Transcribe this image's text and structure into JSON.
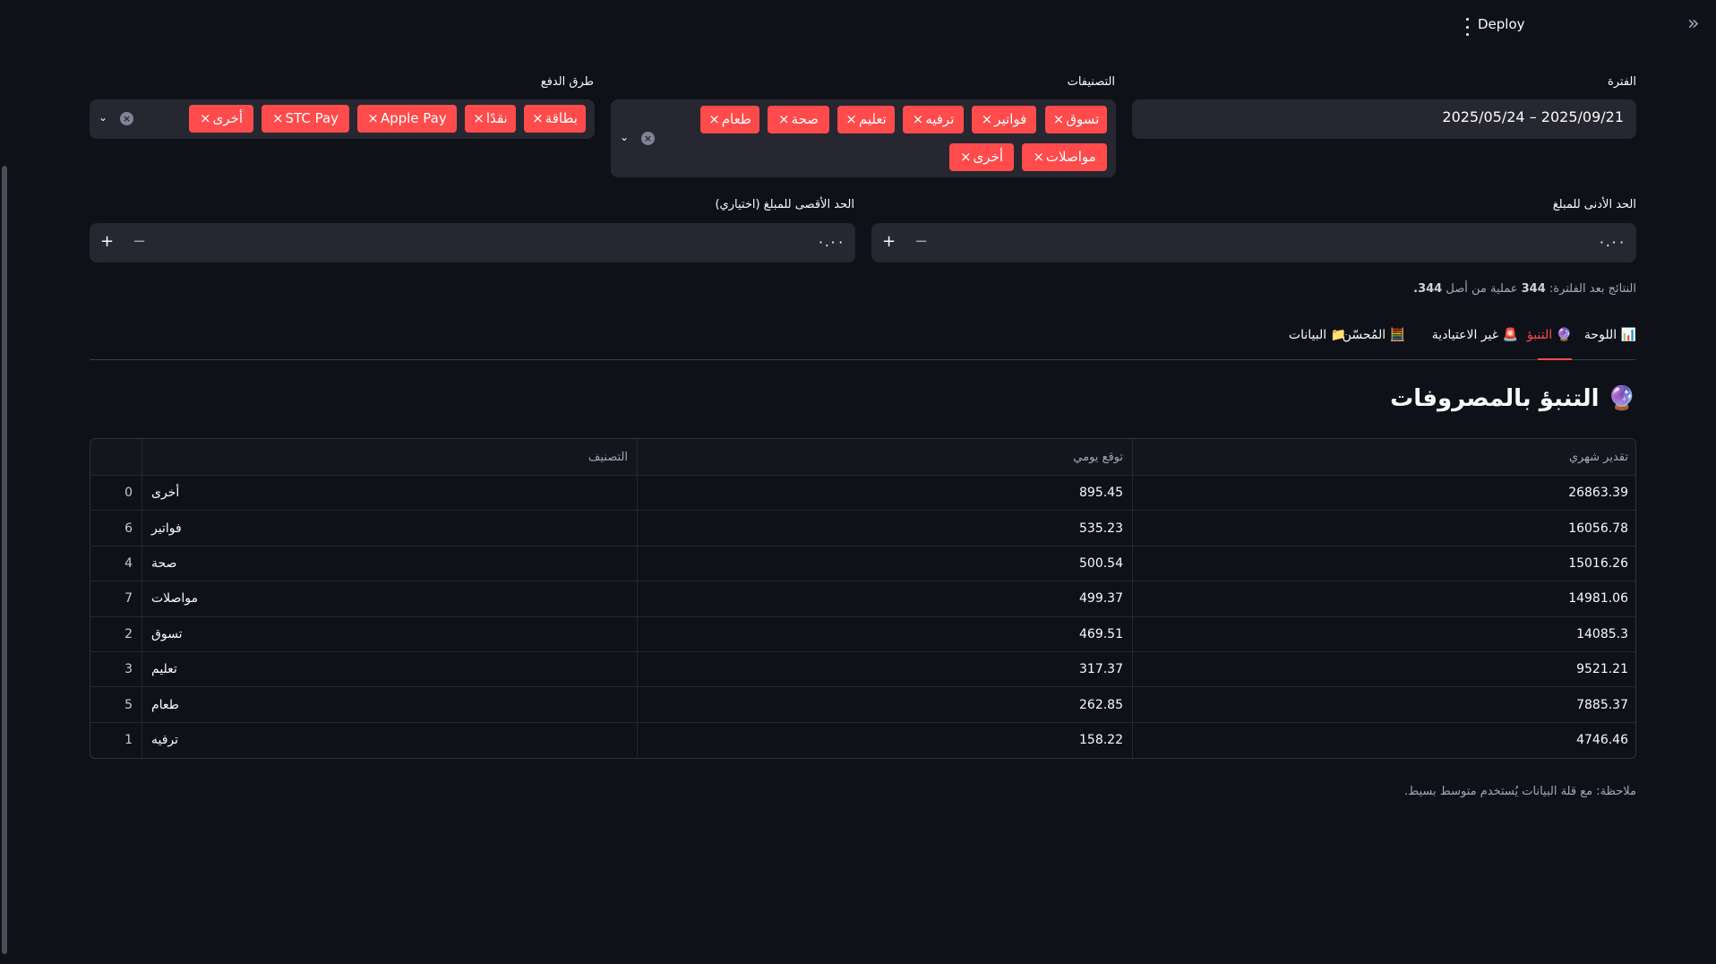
{
  "header": {
    "deploy_label": "Deploy"
  },
  "filters": {
    "period": {
      "label": "الفترة",
      "value": "2025/05/24 – 2025/09/21"
    },
    "categories": {
      "label": "التصنيفات",
      "tags": [
        "تسوق",
        "فواتير",
        "ترفيه",
        "تعليم",
        "صحة",
        "طعام",
        "مواصلات",
        "أخرى"
      ]
    },
    "payment_methods": {
      "label": "طرق الدفع",
      "tags": [
        "بطاقة",
        "نقدًا",
        "Apple Pay",
        "STC Pay",
        "أخرى"
      ]
    },
    "min_amount": {
      "label": "الحد الأدنى للمبلغ",
      "value": "٠.٠٠"
    },
    "max_amount": {
      "label": "الحد الأقصى للمبلغ (اختياري)",
      "value": "٠.٠٠"
    },
    "tag_remove_glyph": "×"
  },
  "results": {
    "prefix": "النتائج بعد الفلترة:",
    "count": "344",
    "middle": "عملية من أصل",
    "total": "344."
  },
  "tabs": [
    {
      "icon": "📊",
      "label": "اللوحة",
      "active": false
    },
    {
      "icon": "🔮",
      "label": "التنبؤ",
      "active": true
    },
    {
      "icon": "🚨",
      "label": "غير الاعتيادية",
      "active": false
    },
    {
      "icon": "🧮",
      "label": "المُحسّن",
      "active": false
    },
    {
      "icon": "📁",
      "label": "البيانات",
      "active": false
    }
  ],
  "section": {
    "icon": "🔮",
    "title": "التنبؤ بالمصروفات"
  },
  "table": {
    "columns": {
      "category": "التصنيف",
      "daily": "توقع يومي",
      "monthly": "تقدير شهري"
    },
    "rows": [
      {
        "index": "0",
        "category": "أخرى",
        "daily": "895.45",
        "monthly": "26863.39"
      },
      {
        "index": "6",
        "category": "فواتير",
        "daily": "535.23",
        "monthly": "16056.78"
      },
      {
        "index": "4",
        "category": "صحة",
        "daily": "500.54",
        "monthly": "15016.26"
      },
      {
        "index": "7",
        "category": "مواصلات",
        "daily": "499.37",
        "monthly": "14981.06"
      },
      {
        "index": "2",
        "category": "تسوق",
        "daily": "469.51",
        "monthly": "14085.3"
      },
      {
        "index": "3",
        "category": "تعليم",
        "daily": "317.37",
        "monthly": "9521.21"
      },
      {
        "index": "5",
        "category": "طعام",
        "daily": "262.85",
        "monthly": "7885.37"
      },
      {
        "index": "1",
        "category": "ترفيه",
        "daily": "158.22",
        "monthly": "4746.46"
      }
    ]
  },
  "note": "ملاحظة: مع قلة البيانات يُستخدم متوسط بسيط.",
  "colors": {
    "background": "#0e1117",
    "surface": "#262730",
    "accent": "#ff4b4b",
    "text": "#fafafa",
    "muted": "#a3a8b8"
  },
  "icons": {
    "menu": "kebab-menu-icon",
    "collapse": "double-chevron-right-icon",
    "clear": "clear-circle-x-icon",
    "dropdown": "chevron-down-icon"
  }
}
